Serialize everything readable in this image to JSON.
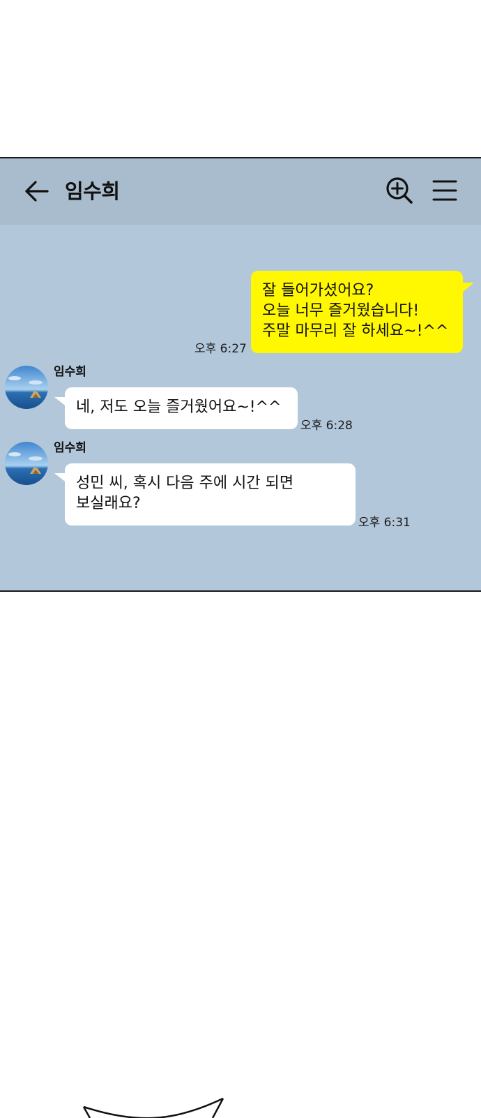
{
  "header": {
    "title": "임수희",
    "back_icon": "arrow-left-icon",
    "search_icon": "zoom-in-icon",
    "menu_icon": "hamburger-menu-icon"
  },
  "colors": {
    "chat_background": "#b2c7da",
    "header_background": "#a9bccd",
    "my_bubble": "#fff800",
    "their_bubble": "#ffffff"
  },
  "messages": [
    {
      "from": "me",
      "lines": [
        "잘 들어가셨어요?",
        "오늘 너무 즐거웠습니다!",
        "주말 마무리 잘 하세요~!^^"
      ],
      "time": "오후 6:27"
    },
    {
      "from": "임수희",
      "sender": "임수희",
      "lines": [
        "네, 저도 오늘 즐거웠어요~!^^"
      ],
      "time": "오후 6:28"
    },
    {
      "from": "임수희",
      "sender": "임수희",
      "lines": [
        "성민 씨, 혹시 다음 주에 시간 되면",
        "보실래요?"
      ],
      "time": "오후 6:31"
    }
  ]
}
